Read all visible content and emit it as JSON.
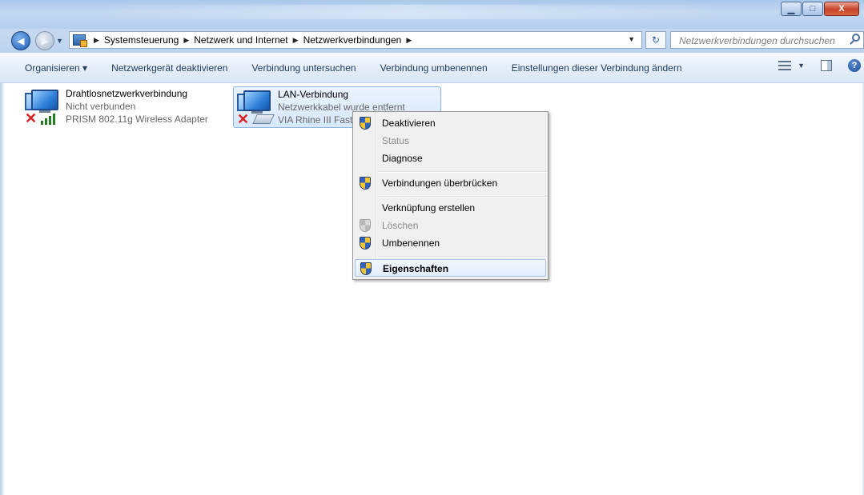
{
  "window": {
    "minimize_glyph": "▁",
    "maximize_glyph": "□",
    "close_glyph": "X"
  },
  "nav": {
    "back_glyph": "◀",
    "forward_glyph": "▶",
    "dropdown_glyph": "▼"
  },
  "breadcrumb": {
    "separator": "▶",
    "items": [
      "Systemsteuerung",
      "Netzwerk und Internet",
      "Netzwerkverbindungen"
    ]
  },
  "search": {
    "placeholder": "Netzwerkverbindungen durchsuchen"
  },
  "toolbar": {
    "items": [
      "Organisieren ▾",
      "Netzwerkgerät deaktivieren",
      "Verbindung untersuchen",
      "Verbindung umbenennen",
      "Einstellungen dieser Verbindung ändern"
    ],
    "help_glyph": "?"
  },
  "connections": [
    {
      "name": "Drahtlosnetzwerkverbindung",
      "status": "Nicht verbunden",
      "adapter": "PRISM 802.11g Wireless Adapter",
      "icon": "wireless-signal-icon",
      "error_icon": "red-x-icon"
    },
    {
      "name": "LAN-Verbindung",
      "status": "Netzwerkkabel wurde entfernt",
      "adapter": "VIA Rhine III Fast",
      "icon": "network-cable-icon",
      "error_icon": "red-x-icon",
      "selected": true
    }
  ],
  "context_menu": {
    "items": [
      {
        "label": "Deaktivieren",
        "shield": true,
        "disabled": false,
        "bold": false
      },
      {
        "label": "Status",
        "shield": false,
        "disabled": true,
        "bold": false
      },
      {
        "label": "Diagnose",
        "shield": false,
        "disabled": false,
        "bold": false
      },
      {
        "label": "Verbindungen überbrücken",
        "shield": true,
        "disabled": false,
        "bold": false
      },
      {
        "label": "Verknüpfung erstellen",
        "shield": false,
        "disabled": false,
        "bold": false
      },
      {
        "label": "Löschen",
        "shield": true,
        "disabled": true,
        "bold": false
      },
      {
        "label": "Umbenennen",
        "shield": true,
        "disabled": false,
        "bold": false
      },
      {
        "label": "Eigenschaften",
        "shield": true,
        "disabled": false,
        "bold": true,
        "hover": true
      }
    ]
  },
  "colors": {
    "selection_bg": "#d6e7fb",
    "selection_border": "#8fb6e6",
    "error_red": "#d81f1f",
    "signal_green": "#2c9b2c"
  }
}
